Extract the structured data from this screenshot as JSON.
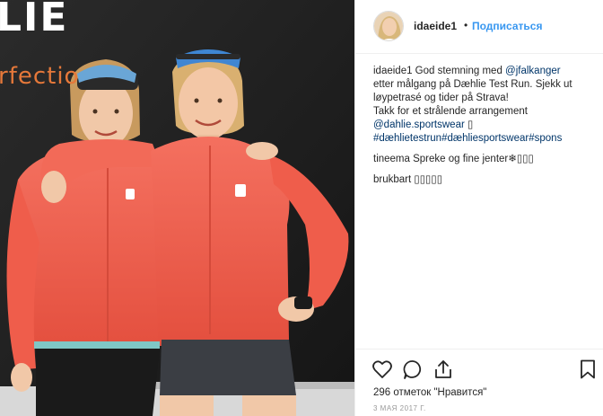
{
  "photo": {
    "banner_top": "LIE",
    "banner_sub": "rfectio"
  },
  "header": {
    "username": "idaeide1",
    "separator": "•",
    "follow_label": "Подписаться"
  },
  "caption": {
    "username": "idaeide1",
    "line1_text": " God stemning med ",
    "line1_mention": "@jfalkanger",
    "line2": "etter målgang på Dæhlie Test Run. Sjekk ut",
    "line3": "løypetrasé og tider på Strava!",
    "line4": "Takk for et strålende arrangement",
    "line5_mention": "@dahlie.sportswear",
    "line5_tail": " ▯",
    "line6": "#dæhlietestrun#dæhliesportswear#spons"
  },
  "comments": [
    {
      "username": "tineema",
      "text": " Spreke og fine jenter❄▯▯▯"
    },
    {
      "username": "brukbart",
      "text": " ▯▯▯▯▯"
    }
  ],
  "footer": {
    "likes_text": "296 отметок \"Нравится\"",
    "date_text": "3 МАЯ 2017 Г."
  },
  "icons": [
    "heart-icon",
    "comment-icon",
    "share-icon",
    "bookmark-icon"
  ],
  "colors": {
    "link": "#003569",
    "follow": "#3897f0",
    "jacket": "#f0604f",
    "background": "#1f1f1f"
  }
}
